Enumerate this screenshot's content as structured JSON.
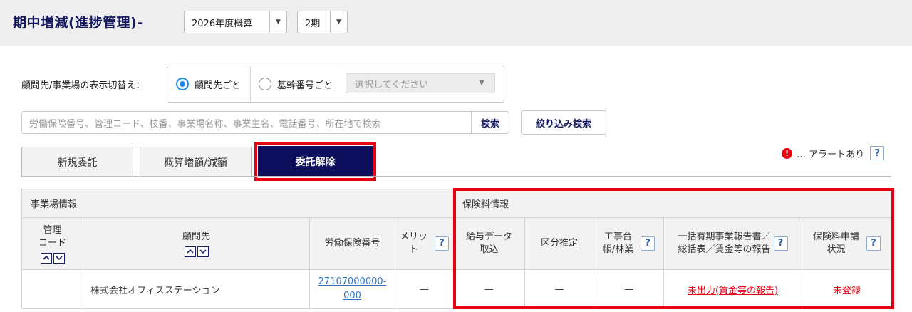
{
  "header": {
    "title": "期中増減(進捗管理)-",
    "fiscal_select": "2026年度概算",
    "period_select": "2期"
  },
  "display_switch": {
    "label": "顧問先/事業場の表示切替え：",
    "options": [
      "顧問先ごと",
      "基幹番号ごと"
    ],
    "selected": "顧問先ごと",
    "base_select_placeholder": "選択してください"
  },
  "search": {
    "placeholder": "労働保険番号、管理コード、枝番、事業場名称、事業主名、電話番号、所在地で検索",
    "search_button": "検索",
    "filter_button": "絞り込み検索"
  },
  "tabs": [
    {
      "label": "新規委託",
      "active": false
    },
    {
      "label": "概算増額/減額",
      "active": false
    },
    {
      "label": "委託解除",
      "active": true
    }
  ],
  "alert_legend": {
    "icon": "!",
    "text": "… アラートあり",
    "help": "?"
  },
  "table": {
    "groups": {
      "business": "事業場情報",
      "insurance": "保険料情報"
    },
    "columns": {
      "mgmt_code": [
        "管理",
        "コード"
      ],
      "client": "顧問先",
      "insurance_no": "労働保険番号",
      "merit": [
        "メリッ",
        "ト"
      ],
      "salary_import": [
        "給与データ",
        "取込"
      ],
      "category": "区分推定",
      "construction": [
        "工事台",
        "帳/林業"
      ],
      "batch_report": [
        "一括有期事業報告書／",
        "総括表／賃金等の報告"
      ],
      "application": [
        "保険料申請",
        "状況"
      ]
    },
    "help": "?",
    "rows": [
      {
        "mgmt_code": "",
        "client": "株式会社オフィスステーション",
        "insurance_no": [
          "27107000000-",
          "000"
        ],
        "merit": "—",
        "salary_import": "—",
        "category": "—",
        "construction": "—",
        "batch_report": "未出力(賃金等の報告)",
        "application": "未登録"
      }
    ]
  },
  "colors": {
    "title_navy": "#12175e",
    "active_tab": "#0d0f5c",
    "highlight_red": "#e60012",
    "link_blue": "#2f73c8",
    "radio_blue": "#1e88e5"
  }
}
